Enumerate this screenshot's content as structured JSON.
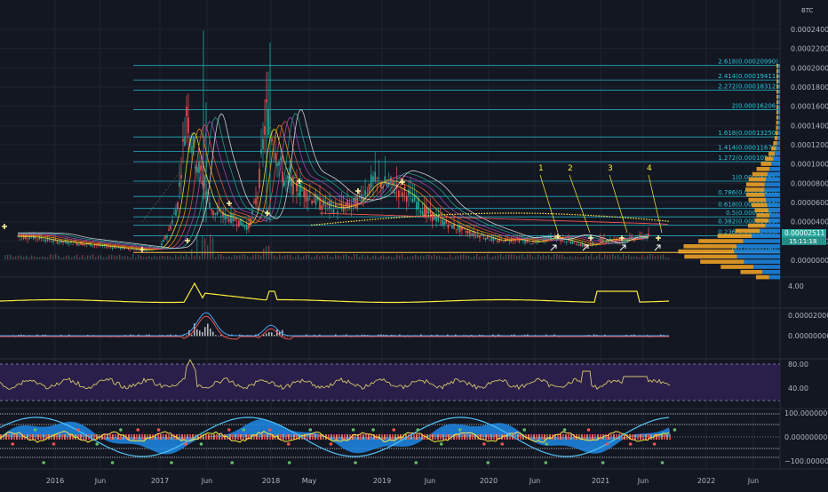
{
  "chart_data": [
    {
      "type": "line",
      "panel": "price",
      "quote_currency": "BTC",
      "y_ticks": [
        "0.00024000",
        "0.00022000",
        "0.00020000",
        "0.00018000",
        "0.00016000",
        "0.00014000",
        "0.00012000",
        "0.00010000",
        "0.00008000",
        "0.00006000",
        "0.00004000",
        "0.00002000",
        "0.00000000"
      ],
      "ylim": [
        0,
        0.00025
      ],
      "x": [
        "2015-09",
        "2015-11",
        "2016-01",
        "2016-03",
        "2016-05",
        "2016-07",
        "2016-09",
        "2016-11",
        "2017-01",
        "2017-02",
        "2017-03",
        "2017-04",
        "2017-05",
        "2017-06",
        "2017-07",
        "2017-09",
        "2017-11",
        "2017-12",
        "2018-01",
        "2018-02",
        "2018-03",
        "2018-04",
        "2018-05",
        "2018-07",
        "2018-09",
        "2018-11",
        "2019-01",
        "2019-03",
        "2019-05",
        "2019-07",
        "2019-09",
        "2019-11",
        "2020-01",
        "2020-03",
        "2020-05",
        "2020-07",
        "2020-09",
        "2020-11",
        "2021-01",
        "2021-03",
        "2021-05",
        "2021-07",
        "2021-08"
      ],
      "series": [
        {
          "values": [
            2.5e-05,
            2.4e-05,
            2e-05,
            1.8e-05,
            1.6e-05,
            1.4e-05,
            1.2e-05,
            1e-05,
            1.2e-05,
            3e-05,
            6e-05,
            0.00016,
            0.00011,
            8e-05,
            5e-05,
            4.5e-05,
            3.5e-05,
            7e-05,
            0.00016,
            0.00012,
            8.5e-05,
            8e-05,
            7.5e-05,
            6e-05,
            5.5e-05,
            6e-05,
            8.5e-05,
            8e-05,
            7e-05,
            5e-05,
            4e-05,
            3.2e-05,
            2.6e-05,
            2e-05,
            2.2e-05,
            1.8e-05,
            2.4e-05,
            2e-05,
            1.4e-05,
            2.2e-05,
            2e-05,
            2.4e-05,
            2.5e-05
          ]
        }
      ],
      "fib_levels": [
        {
          "label": "0(0.00000740)",
          "value": 7.4e-06
        },
        {
          "label": "0.236(0.00002553)",
          "value": 2.553e-05
        },
        {
          "label": "0.382(0.00003683)",
          "value": 3.683e-05
        },
        {
          "label": "0.5(0.00004597)",
          "value": 4.597e-05
        },
        {
          "label": "0.618(0.00005510)",
          "value": 5.51e-05
        },
        {
          "label": "0.786(0.00006810)",
          "value": 6.81e-05
        },
        {
          "label": "1(0.00008465)",
          "value": 8.465e-05
        },
        {
          "label": "1.272(0.00010572)",
          "value": 0.00010572
        },
        {
          "label": "1.414(0.00011670)",
          "value": 0.0001167
        },
        {
          "label": "1.618(0.00013250)",
          "value": 0.0001325
        },
        {
          "label": "2(0.00016206)",
          "value": 0.00016206
        },
        {
          "label": "2.272(0.00018312)",
          "value": 0.00018312
        },
        {
          "label": "2.414(0.00019411)",
          "value": 0.00019411
        },
        {
          "label": "2.618(0.00020990)",
          "value": 0.0002099
        }
      ],
      "annotations": [
        {
          "label": "1",
          "x": "2020-09"
        },
        {
          "label": "2",
          "x": "2020-11"
        },
        {
          "label": "3",
          "x": "2021-03"
        },
        {
          "label": "4",
          "x": "2021-06"
        }
      ],
      "last_price": "0.00002511",
      "countdown": "15:11:18"
    },
    {
      "type": "line",
      "panel": "indicator-1",
      "y_ticks": [
        "4.00"
      ]
    },
    {
      "type": "line",
      "panel": "macd",
      "y_ticks": [
        "0.00002000",
        "0.00000000"
      ]
    },
    {
      "type": "line",
      "panel": "rsi",
      "y_ticks": [
        "80.00",
        "40.00"
      ]
    },
    {
      "type": "area",
      "panel": "oscillator",
      "y_ticks": [
        "100.00000000",
        "0.00000000",
        "−100.00000000"
      ]
    }
  ],
  "x_axis_labels": [
    "2016",
    "Jun",
    "2017",
    "Jun",
    "2018",
    "May",
    "2019",
    "Jun",
    "2020",
    "Jun",
    "2021",
    "Jun",
    "2022",
    "Jun"
  ],
  "colors": {
    "background": "#131722",
    "grid": "#1f2331",
    "fib": "#26c6da",
    "price_up": "#26a69a",
    "price_down": "#ef5350",
    "ribbon": [
      "#ffeb3b",
      "#ff9800",
      "#ef5350",
      "#ab47bc",
      "#26a69a",
      "#e0e0e0"
    ],
    "volume_profile_a": "#1e88e5",
    "volume_profile_b": "#f9a825",
    "rsi_band": "#2a1f4a",
    "text": "#b2b5be"
  }
}
